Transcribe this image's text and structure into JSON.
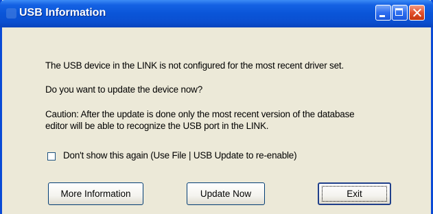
{
  "window": {
    "title": "USB Information",
    "icon": "app-icon",
    "controls": [
      "minimize-icon",
      "maximize-icon",
      "close-icon"
    ]
  },
  "dialog": {
    "message1": "The USB device in the LINK is not configured for the most recent driver set.",
    "message2": "Do you want to update the device now?",
    "message3_line1": "Caution: After the update is done only the most recent version of the database",
    "message3_line2": "editor will be able to recognize the USB port in the LINK.",
    "checkbox_label": "Don't show this again (Use File | USB Update to re-enable)",
    "checkbox_checked": false
  },
  "buttons": {
    "more_information": "More Information",
    "update_now": "Update Now",
    "exit": "Exit"
  },
  "colors": {
    "titlebar": "#0a55d8",
    "dialog_background": "#ece9d8",
    "close_button": "#e3502d"
  }
}
